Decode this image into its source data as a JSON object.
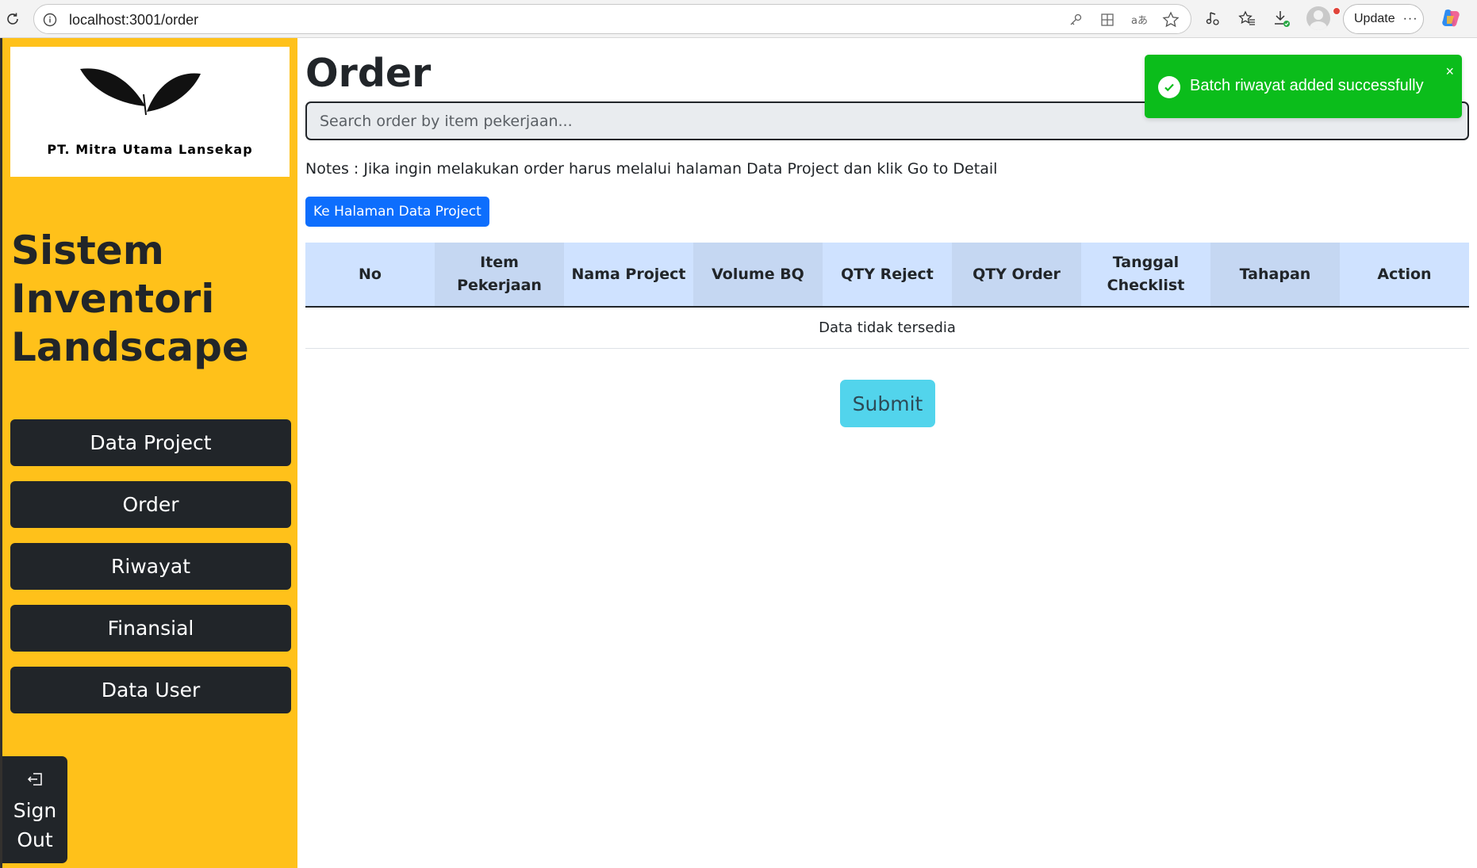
{
  "browser": {
    "url": "localhost:3001/order",
    "update_label": "Update",
    "menu_dots": "···"
  },
  "sidebar": {
    "logo_caption": "PT. Mitra Utama Lansekap",
    "app_title": "Sistem Inventori Landscape",
    "nav_items": [
      {
        "label": "Data Project"
      },
      {
        "label": "Order"
      },
      {
        "label": "Riwayat"
      },
      {
        "label": "Finansial"
      },
      {
        "label": "Data User"
      }
    ],
    "sign_out_label_1": "Sign",
    "sign_out_label_2": "Out"
  },
  "main": {
    "title": "Order",
    "search_placeholder": "Search order by item pekerjaan...",
    "notes": "Notes : Jika ingin melakukan order harus melalui halaman Data Project dan klik Go to Detail",
    "goto_button": "Ke Halaman Data Project",
    "table": {
      "headers": [
        "No",
        "Item Pekerjaan",
        "Nama Project",
        "Volume BQ",
        "QTY Reject",
        "QTY Order",
        "Tanggal Checklist",
        "Tahapan",
        "Action"
      ],
      "empty_message": "Data tidak tersedia"
    },
    "submit_label": "Submit"
  },
  "toast": {
    "message": "Batch riwayat added successfully",
    "close_glyph": "×",
    "color": "#0bbd1b"
  },
  "colors": {
    "sidebar_bg": "#ffc11a",
    "nav_bg": "#212529",
    "primary": "#0d6efd",
    "info": "#52d4ec",
    "table_header": "#cfe2ff"
  }
}
